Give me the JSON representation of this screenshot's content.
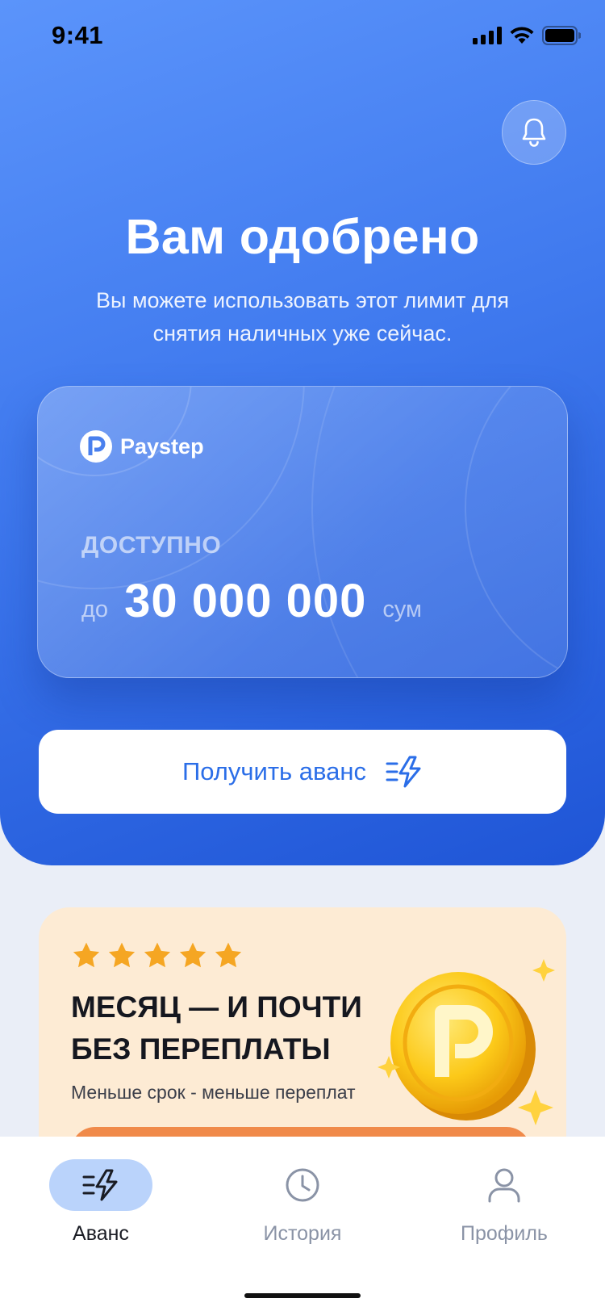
{
  "status_bar": {
    "time": "9:41"
  },
  "hero": {
    "title": "Вам одобрено",
    "subtitle": "Вы можете использовать этот лимит для снятия наличных уже сейчас."
  },
  "card": {
    "brand": "Paystep",
    "available_label": "ДОСТУПНО",
    "amount_prefix": "до",
    "amount": "30 000 000",
    "currency": "сум"
  },
  "advance_button": {
    "label": "Получить аванс",
    "icon": "lightning-icon"
  },
  "promo": {
    "rating": 5,
    "title": "МЕСЯЦ — И ПОЧТИ БЕЗ ПЕРЕПЛАТЫ",
    "subtitle": "Меньше срок - меньше переплат"
  },
  "tabbar": {
    "tabs": [
      {
        "label": "Аванс",
        "icon": "lightning-icon",
        "active": true
      },
      {
        "label": "История",
        "icon": "clock-icon",
        "active": false
      },
      {
        "label": "Профиль",
        "icon": "user-icon",
        "active": false
      }
    ]
  },
  "colors": {
    "accent": "#2b6ee8",
    "hero_top": "#5b94fb",
    "hero_bottom": "#1f55d6",
    "promo_bg": "#fdebd4",
    "promo_cta": "#f08a4a",
    "star": "#f5a623",
    "tab_active_pill": "#bad3fb"
  }
}
